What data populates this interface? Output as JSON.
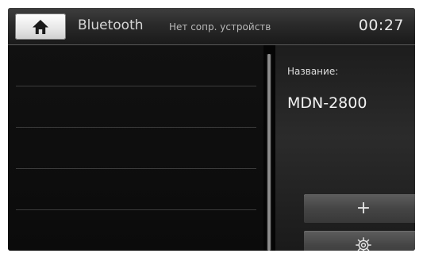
{
  "header": {
    "home_icon": "home-icon",
    "title": "Bluetooth",
    "status": "Нет сопр. устройств",
    "clock": "00:27"
  },
  "device_list": {
    "rows": [
      "",
      "",
      "",
      "",
      ""
    ]
  },
  "details": {
    "name_label": "Название:",
    "name_value": "MDN-2800"
  },
  "actions": {
    "add_label": "+",
    "add_icon": "plus-icon",
    "settings_icon": "gear-icon"
  },
  "colors": {
    "background": "#050505",
    "top_bar": "#2a2a2a",
    "button": "#454545",
    "text": "#e8e8e8"
  }
}
